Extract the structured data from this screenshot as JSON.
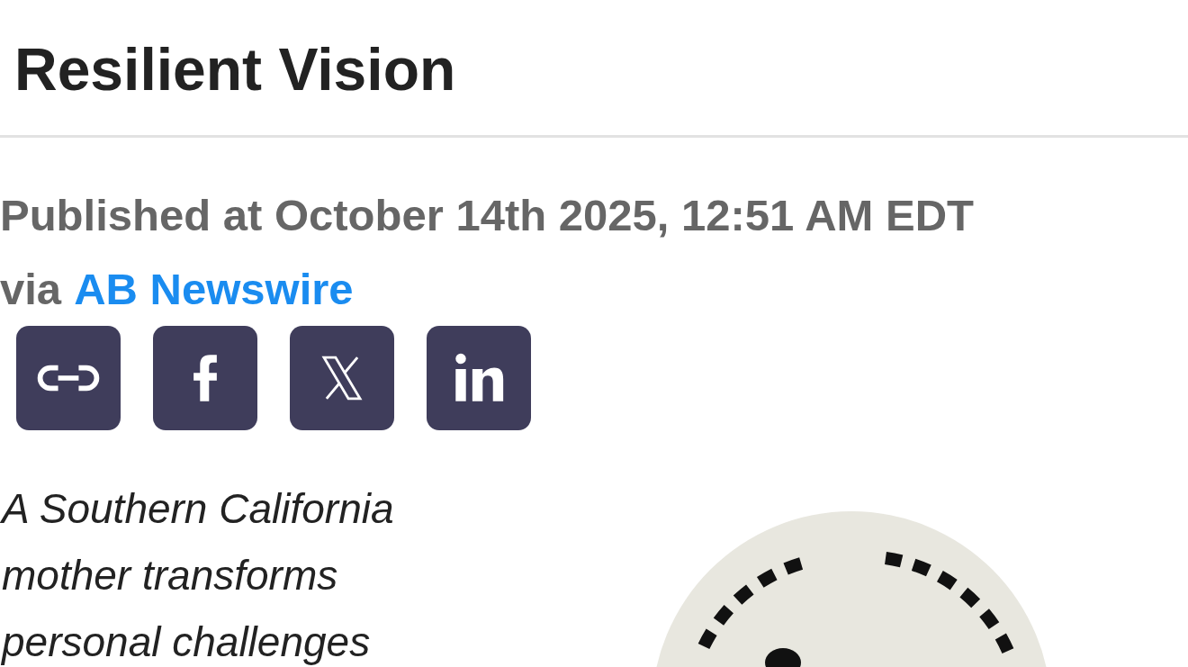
{
  "title": "Resilient Vision",
  "byline": {
    "published": "Published at October 14th 2025, 12:51 AM EDT",
    "via": "via",
    "source": "AB Newswire"
  },
  "share_buttons": [
    {
      "kind": "link"
    },
    {
      "kind": "facebook"
    },
    {
      "kind": "x"
    },
    {
      "kind": "linkedin"
    }
  ],
  "summary": "A Southern California mother transforms personal challenges"
}
